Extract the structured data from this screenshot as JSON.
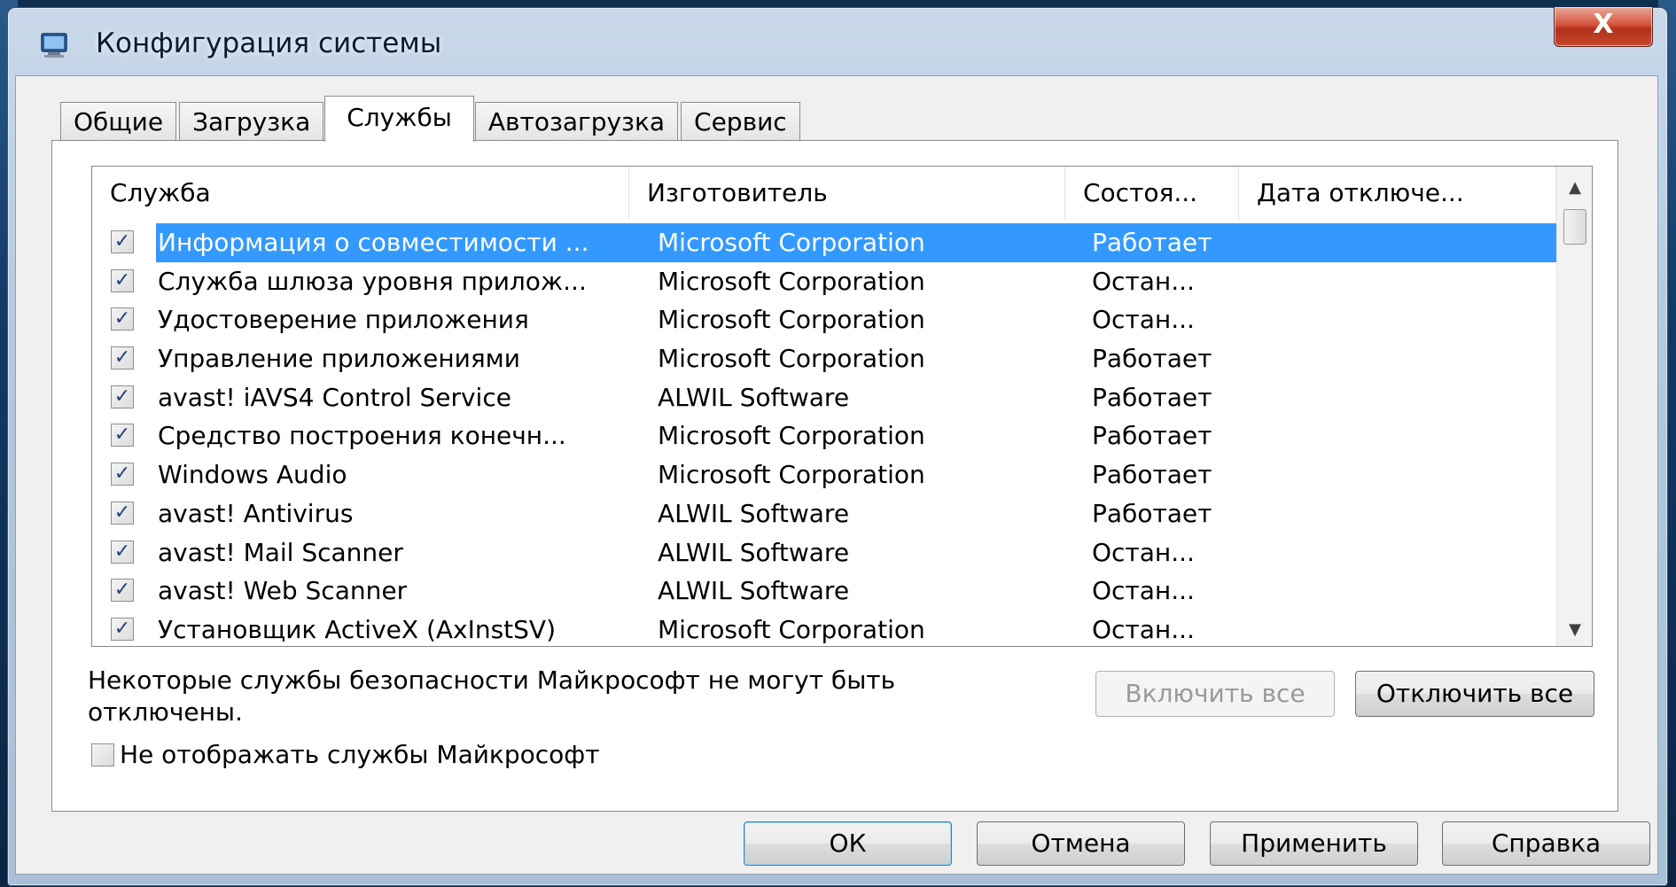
{
  "window": {
    "title": "Конфигурация системы",
    "close_glyph": "X"
  },
  "tabs": [
    {
      "label": "Общие",
      "active": false
    },
    {
      "label": "Загрузка",
      "active": false
    },
    {
      "label": "Службы",
      "active": true
    },
    {
      "label": "Автозагрузка",
      "active": false
    },
    {
      "label": "Сервис",
      "active": false
    }
  ],
  "services": {
    "columns": [
      "Служба",
      "Изготовитель",
      "Состоя...",
      "Дата отключе..."
    ],
    "rows": [
      {
        "name": "Информация о совместимости ...",
        "maker": "Microsoft Corporation",
        "state": "Работает",
        "checked": true,
        "selected": true
      },
      {
        "name": "Служба шлюза уровня прилож...",
        "maker": "Microsoft Corporation",
        "state": "Остан...",
        "checked": true,
        "selected": false
      },
      {
        "name": "Удостоверение приложения",
        "maker": "Microsoft Corporation",
        "state": "Остан...",
        "checked": true,
        "selected": false
      },
      {
        "name": "Управление приложениями",
        "maker": "Microsoft Corporation",
        "state": "Работает",
        "checked": true,
        "selected": false
      },
      {
        "name": "avast! iAVS4 Control Service",
        "maker": "ALWIL Software",
        "state": "Работает",
        "checked": true,
        "selected": false
      },
      {
        "name": "Средство построения конечн...",
        "maker": "Microsoft Corporation",
        "state": "Работает",
        "checked": true,
        "selected": false
      },
      {
        "name": "Windows Audio",
        "maker": "Microsoft Corporation",
        "state": "Работает",
        "checked": true,
        "selected": false
      },
      {
        "name": "avast! Antivirus",
        "maker": "ALWIL Software",
        "state": "Работает",
        "checked": true,
        "selected": false
      },
      {
        "name": "avast! Mail Scanner",
        "maker": "ALWIL Software",
        "state": "Остан...",
        "checked": true,
        "selected": false
      },
      {
        "name": "avast! Web Scanner",
        "maker": "ALWIL Software",
        "state": "Остан...",
        "checked": true,
        "selected": false
      },
      {
        "name": "Установщик ActiveX (AxInstSV)",
        "maker": "Microsoft Corporation",
        "state": "Остан...",
        "checked": true,
        "selected": false
      }
    ]
  },
  "note": "Некоторые службы безопасности Майкрософт не могут быть отключены.",
  "buttons": {
    "enable_all": "Включить все",
    "disable_all": "Отключить все",
    "ok": "ОК",
    "cancel": "Отмена",
    "apply": "Применить",
    "help": "Справка"
  },
  "hide_ms": {
    "label": "Не отображать службы Майкрософт",
    "checked": false
  },
  "colors": {
    "selection": "#3399ff",
    "close_button": "#c4482f"
  },
  "icons": {
    "title": "msconfig-icon",
    "check": "checkmark-icon",
    "scroll_up": "arrow-up-icon",
    "scroll_down": "arrow-down-icon"
  }
}
